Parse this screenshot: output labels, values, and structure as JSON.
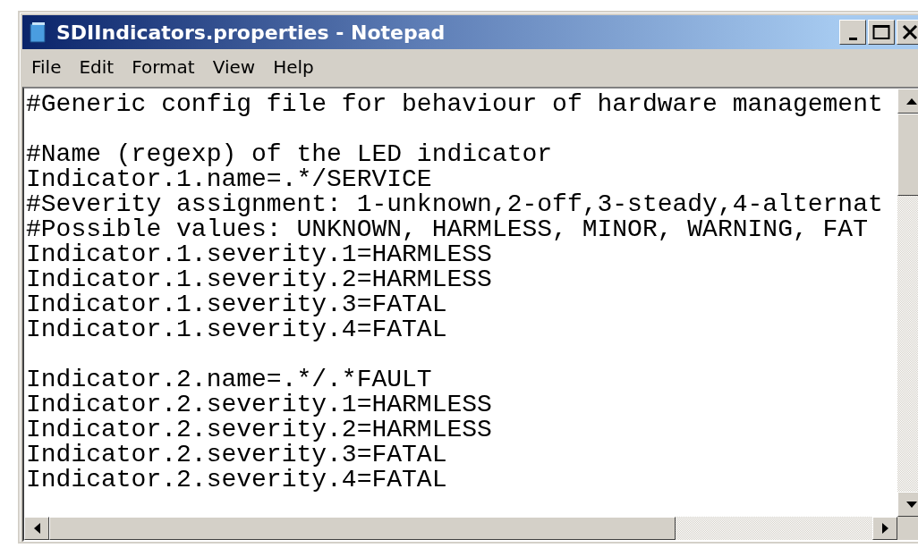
{
  "window": {
    "title": "SDIIndicators.properties - Notepad"
  },
  "menu": [
    "File",
    "Edit",
    "Format",
    "View",
    "Help"
  ],
  "editor": {
    "blocks": [
      [
        "#Generic config file for behaviour of hardware management"
      ],
      [
        "#Name (regexp) of the LED indicator",
        "Indicator.1.name=.*/SERVICE",
        "#Severity assignment: 1-unknown,2-off,3-steady,4-alternat",
        "#Possible values: UNKNOWN, HARMLESS, MINOR, WARNING, FAT",
        "Indicator.1.severity.1=HARMLESS",
        "Indicator.1.severity.2=HARMLESS",
        "Indicator.1.severity.3=FATAL",
        "Indicator.1.severity.4=FATAL"
      ],
      [
        "Indicator.2.name=.*/.*FAULT",
        "Indicator.2.severity.1=HARMLESS",
        "Indicator.2.severity.2=HARMLESS",
        "Indicator.2.severity.3=FATAL",
        "Indicator.2.severity.4=FATAL"
      ]
    ]
  }
}
